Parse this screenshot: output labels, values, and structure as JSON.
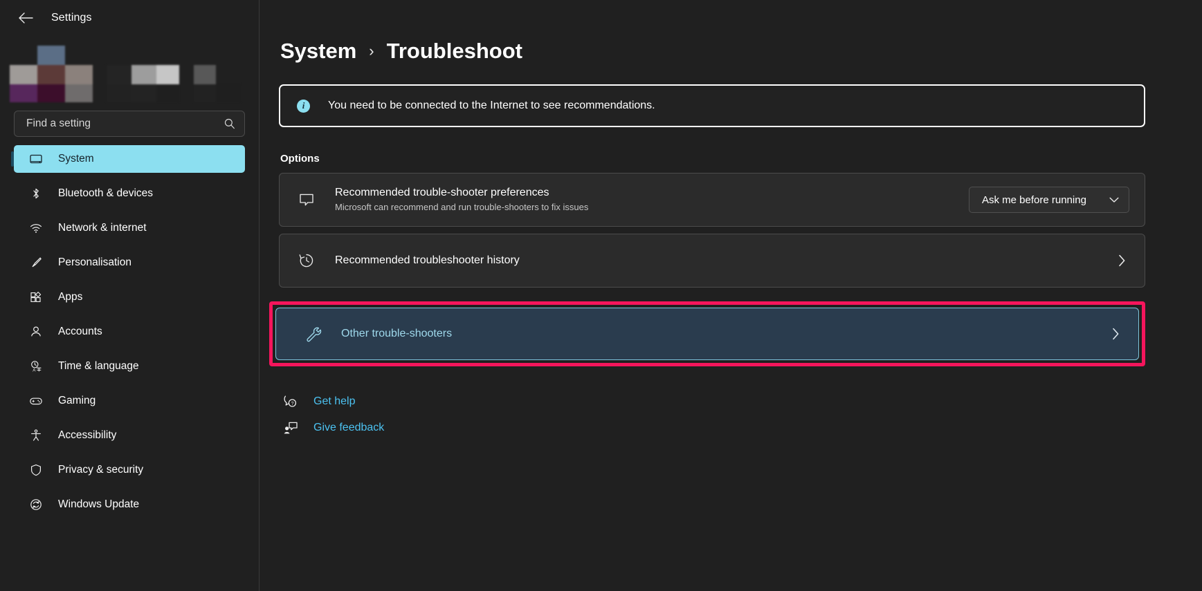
{
  "window": {
    "app_title": "Settings",
    "back_icon": "back-arrow-icon"
  },
  "sidebar": {
    "search": {
      "placeholder": "Find a setting",
      "value": "",
      "icon": "search-icon"
    },
    "items": [
      {
        "label": "System",
        "icon": "monitor-icon",
        "selected": true
      },
      {
        "label": "Bluetooth & devices",
        "icon": "bluetooth-icon",
        "selected": false
      },
      {
        "label": "Network & internet",
        "icon": "wifi-icon",
        "selected": false
      },
      {
        "label": "Personalisation",
        "icon": "paintbrush-icon",
        "selected": false
      },
      {
        "label": "Apps",
        "icon": "apps-grid-icon",
        "selected": false
      },
      {
        "label": "Accounts",
        "icon": "person-icon",
        "selected": false
      },
      {
        "label": "Time & language",
        "icon": "clock-language-icon",
        "selected": false
      },
      {
        "label": "Gaming",
        "icon": "gamepad-icon",
        "selected": false
      },
      {
        "label": "Accessibility",
        "icon": "accessibility-icon",
        "selected": false
      },
      {
        "label": "Privacy & security",
        "icon": "shield-icon",
        "selected": false
      },
      {
        "label": "Windows Update",
        "icon": "update-refresh-icon",
        "selected": false
      }
    ]
  },
  "main": {
    "breadcrumb": {
      "parent": "System",
      "separator": "›",
      "current": "Troubleshoot"
    },
    "banner": {
      "icon": "info-icon",
      "badge": "i",
      "text": "You need to be connected to the Internet to see recommendations."
    },
    "section_title": "Options",
    "options": [
      {
        "icon": "chat-bubble-icon",
        "title": "Recommended trouble-shooter preferences",
        "subtitle": "Microsoft can recommend and run trouble-shooters to fix issues",
        "control": "dropdown",
        "dropdown_value": "Ask me before running",
        "dropdown_icon": "chevron-down-icon"
      },
      {
        "icon": "history-icon",
        "title": "Recommended troubleshooter history",
        "subtitle": "",
        "control": "chevron",
        "chevron_icon": "chevron-right-icon"
      },
      {
        "icon": "wrench-icon",
        "title": "Other trouble-shooters",
        "subtitle": "",
        "control": "chevron",
        "chevron_icon": "chevron-right-icon",
        "highlighted": true
      }
    ],
    "links": [
      {
        "label": "Get help",
        "icon": "help-bubble-icon"
      },
      {
        "label": "Give feedback",
        "icon": "feedback-icon"
      }
    ]
  },
  "colors": {
    "page_background": "#202020",
    "accent_cyan": "#8cdff0",
    "link_blue": "#4cc2f1",
    "highlight_pink": "#f5155c",
    "selected_row_bg": "#2a3c4e",
    "card_bg": "#2b2b2b"
  }
}
